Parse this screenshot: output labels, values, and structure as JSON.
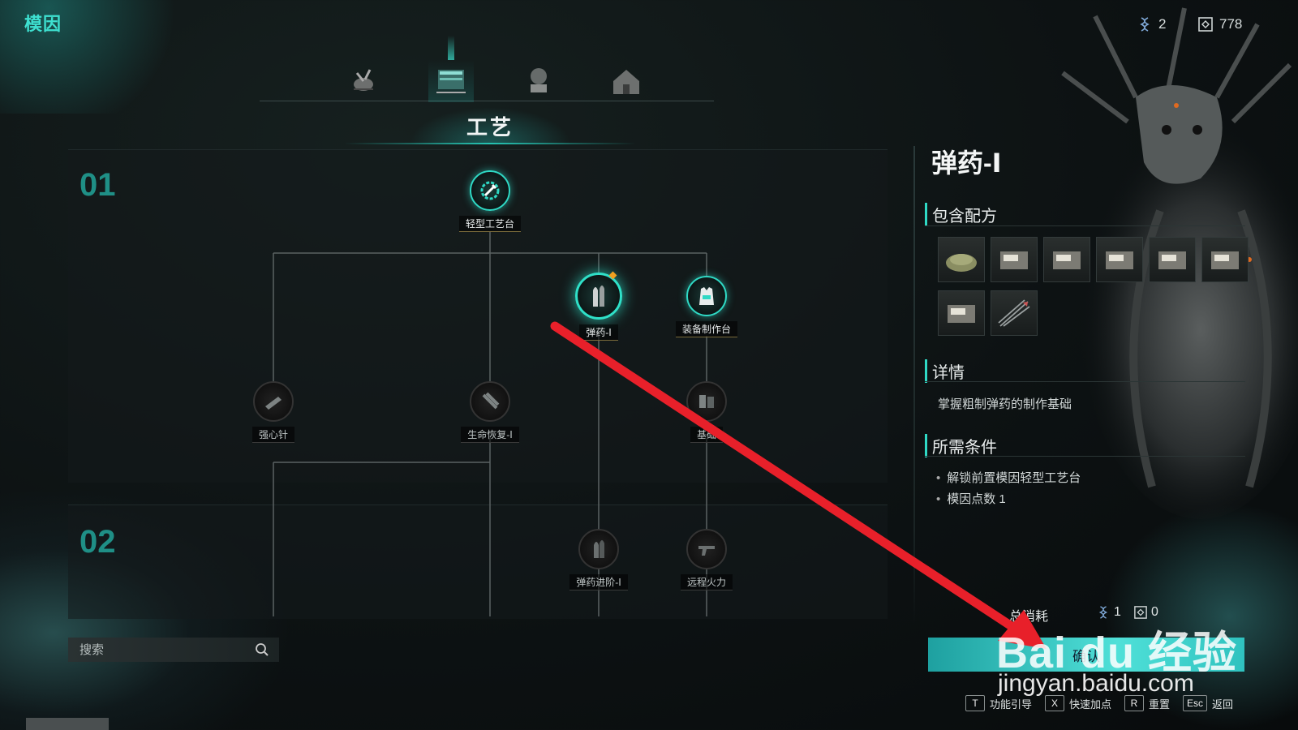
{
  "app_title": "模因",
  "currency": {
    "points": "2",
    "resource": "778"
  },
  "category_tabs": [
    {
      "name": "weapons",
      "icon": "bee-weapon-icon"
    },
    {
      "name": "crafting",
      "icon": "workbench-icon",
      "active": true
    },
    {
      "name": "farming",
      "icon": "plant-pot-icon"
    },
    {
      "name": "building",
      "icon": "house-icon"
    }
  ],
  "section_title": "工艺",
  "tiers": [
    "01",
    "02"
  ],
  "nodes": {
    "light_workbench": "轻型工艺台",
    "ammo1": "弹药-Ⅰ",
    "equip_bench": "装备制作台",
    "strong_heart": "强心针",
    "heal1": "生命恢复-Ⅰ",
    "basic": "基础",
    "ammo_adv": "弹药进阶-Ⅰ",
    "ranged": "远程火力"
  },
  "search": {
    "placeholder": "搜索"
  },
  "detail": {
    "title": "弹药-Ⅰ",
    "recipes_heading": "包含配方",
    "recipes": [
      "gunpowder-icon",
      "ammo-box-icon",
      "ammo-box-icon",
      "ammo-box-icon",
      "ammo-box-icon",
      "ammo-box-icon",
      "ammo-box-icon",
      "arrows-icon"
    ],
    "details_heading": "详情",
    "details_text": "掌握粗制弹药的制作基础",
    "requirements_heading": "所需条件",
    "requirements": [
      "解锁前置模因轻型工艺台",
      "模因点数 1"
    ]
  },
  "cost": {
    "label": "总消耗",
    "points": "1",
    "resource": "0"
  },
  "confirm_label": "确认",
  "hints": [
    {
      "key": "T",
      "label": "功能引导"
    },
    {
      "key": "X",
      "label": "快速加点"
    },
    {
      "key": "R",
      "label": "重置"
    },
    {
      "key": "Esc",
      "label": "返回"
    }
  ],
  "watermark": {
    "logo": "Bai du 经验",
    "url": "jingyan.baidu.com"
  },
  "colors": {
    "accent": "#2fd9c5",
    "arrow": "#e8202a"
  }
}
